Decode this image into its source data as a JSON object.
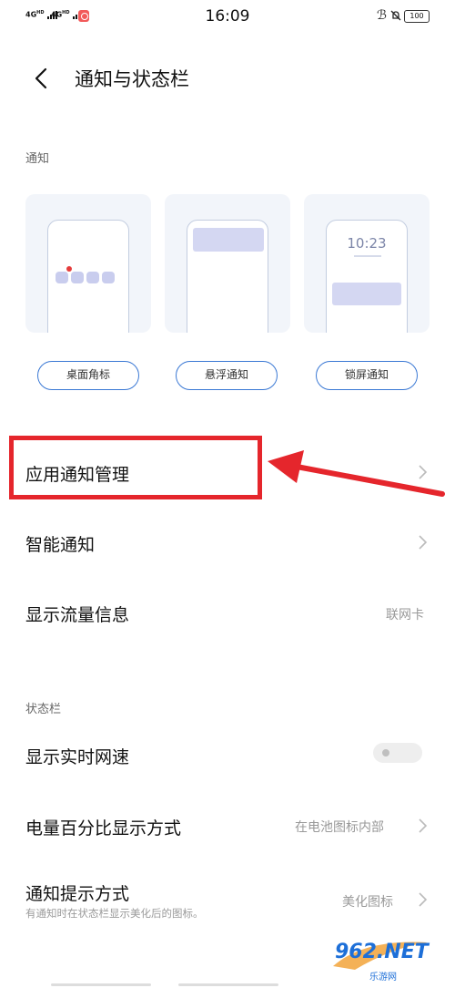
{
  "status_bar": {
    "sim1": "4G",
    "sim1_sup": "HD",
    "sim2": "4G",
    "sim2_sup": "HD",
    "time": "16:09",
    "battery": "100"
  },
  "header": {
    "title": "通知与状态栏"
  },
  "notification_section": {
    "label": "通知",
    "lock_time": "10:23",
    "buttons": [
      "桌面角标",
      "悬浮通知",
      "锁屏通知"
    ]
  },
  "rows": [
    {
      "label": "应用通知管理",
      "value": ""
    },
    {
      "label": "智能通知",
      "value": ""
    },
    {
      "label": "显示流量信息",
      "value": "联网卡"
    }
  ],
  "status_section": {
    "label": "状态栏",
    "rows": [
      {
        "label": "显示实时网速"
      },
      {
        "label": "电量百分比显示方式",
        "value": "在电池图标内部"
      },
      {
        "label": "通知提示方式",
        "value": "美化图标",
        "sub": "有通知时在状态栏显示美化后的图标。"
      }
    ]
  },
  "watermark": {
    "text": "962.NET",
    "sub": "乐游网"
  },
  "colors": {
    "accent": "#3a78d4",
    "highlight": "#e5262c",
    "watermark": "#1d6fd8"
  }
}
